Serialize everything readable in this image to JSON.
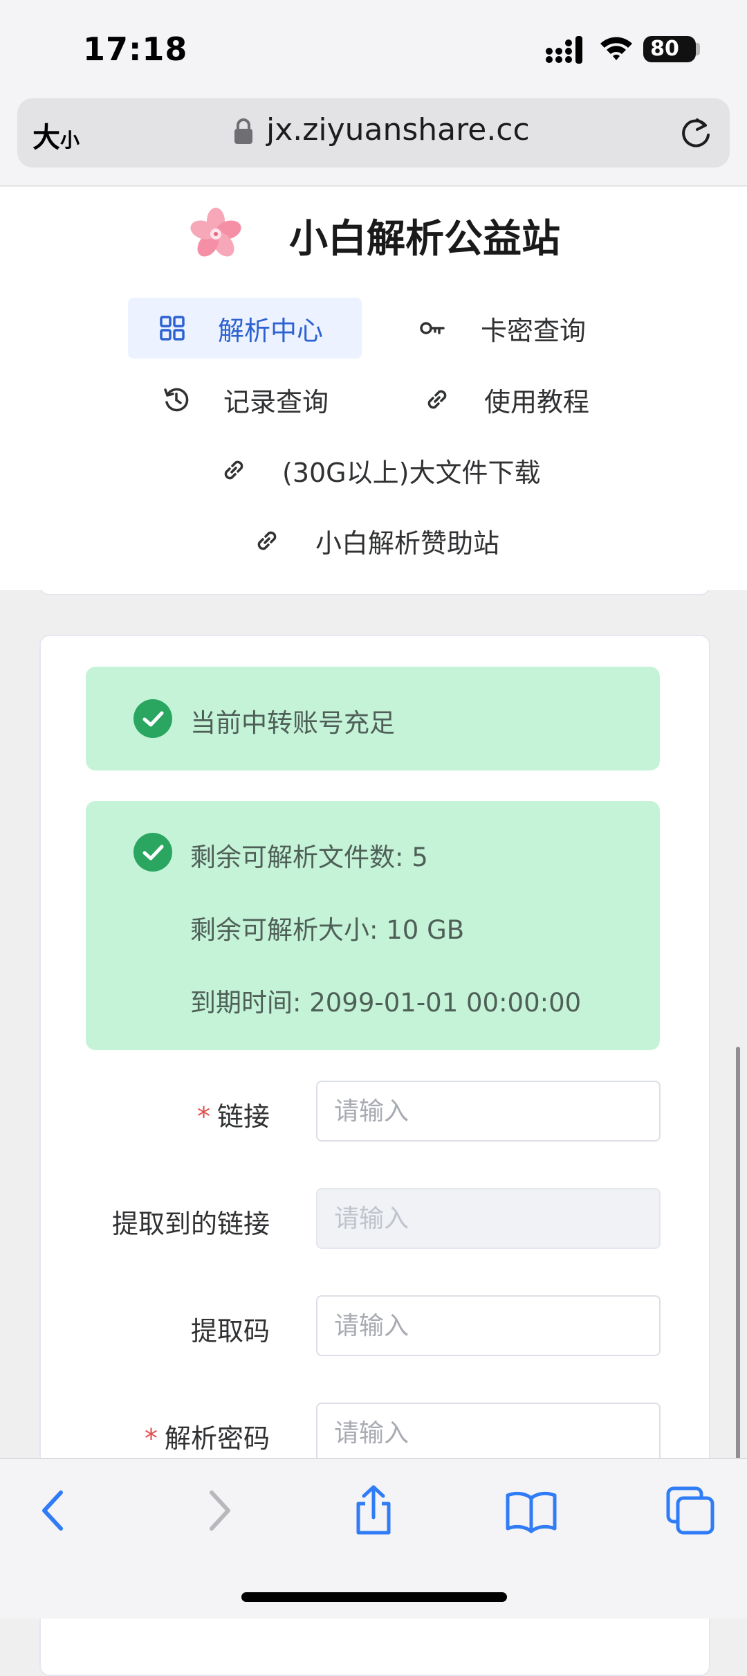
{
  "status_bar": {
    "time": "17:18",
    "battery": "80"
  },
  "browser": {
    "text_size_large": "大",
    "text_size_small": "小",
    "url": "jx.ziyuanshare.cc"
  },
  "site": {
    "title": "小白解析公益站"
  },
  "nav": {
    "parse_center": "解析中心",
    "card_query": "卡密查询",
    "record_query": "记录查询",
    "tutorial": "使用教程",
    "big_file_download": "(30G以上)大文件下载",
    "sponsor_site": "小白解析赞助站"
  },
  "alerts": {
    "relay_status": "当前中转账号充足",
    "remaining_files": "剩余可解析文件数: 5",
    "remaining_size": "剩余可解析大小: 10 GB",
    "expiry": "到期时间: 2099-01-01 00:00:00"
  },
  "form": {
    "required_mark": "*",
    "link_label": "链接",
    "extracted_link_label": "提取到的链接",
    "extract_code_label": "提取码",
    "parse_password_label": "解析密码",
    "placeholder": "请输入"
  },
  "colors": {
    "accent": "#2d62d2",
    "nav_active_bg": "#ecf2ff",
    "success_bg": "#c5f3d8",
    "success_icon": "#2aa661",
    "required": "#e34d4d"
  }
}
